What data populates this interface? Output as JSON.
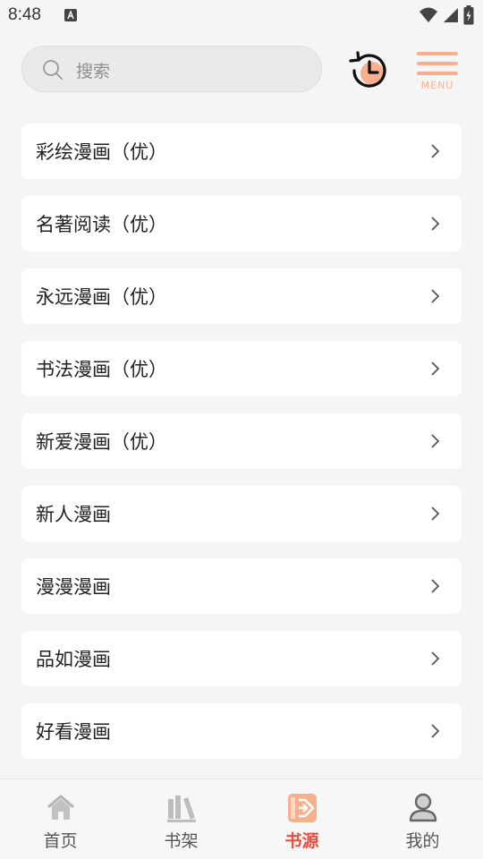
{
  "status_bar": {
    "time": "8:48"
  },
  "header": {
    "search_placeholder": "搜索",
    "menu_label": "MENU"
  },
  "colors": {
    "accent": "#f6b08e",
    "active_nav": "#e84d3d",
    "background": "#f5f5f5"
  },
  "sources": [
    {
      "label": "彩绘漫画（优）"
    },
    {
      "label": "名著阅读（优）"
    },
    {
      "label": "永远漫画（优）"
    },
    {
      "label": "书法漫画（优）"
    },
    {
      "label": "新爱漫画（优）"
    },
    {
      "label": "新人漫画"
    },
    {
      "label": "漫漫漫画"
    },
    {
      "label": "品如漫画"
    },
    {
      "label": "好看漫画"
    }
  ],
  "bottom_nav": {
    "items": [
      {
        "label": "首页",
        "icon": "home-icon"
      },
      {
        "label": "书架",
        "icon": "bookshelf-icon"
      },
      {
        "label": "书源",
        "icon": "source-icon",
        "active": true
      },
      {
        "label": "我的",
        "icon": "profile-icon"
      }
    ]
  }
}
